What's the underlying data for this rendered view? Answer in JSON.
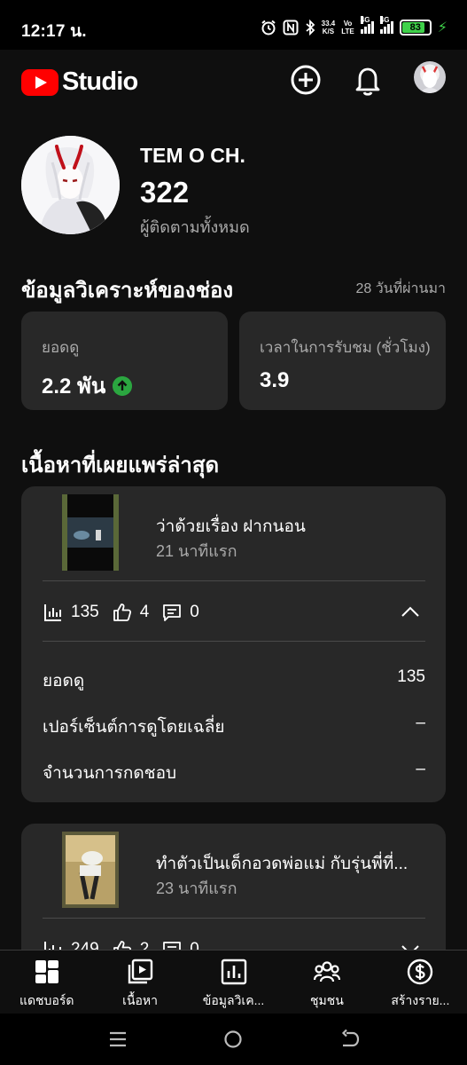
{
  "status_bar": {
    "time": "12:17 น.",
    "speed_value": "33.4",
    "speed_unit": "K/S",
    "volte_top": "Vo",
    "volte_bottom": "LTE",
    "net1": "4G",
    "net2": "4G",
    "battery": "83"
  },
  "app": {
    "logo_text": "Studio"
  },
  "channel": {
    "name": "TEM O CH.",
    "subscriber_count": "322",
    "subscriber_label": "ผู้ติดตามทั้งหมด"
  },
  "analytics": {
    "title": "ข้อมูลวิเคราะห์ของช่อง",
    "period": "28 วันที่ผ่านมา",
    "cards": [
      {
        "label": "ยอดดู",
        "value": "2.2 พัน",
        "trend": "up"
      },
      {
        "label": "เวลาในการรับชม (ชั่วโมง)",
        "value": "3.9"
      }
    ]
  },
  "latest": {
    "title": "เนื้อหาที่เผยแพร่ล่าสุด",
    "videos": [
      {
        "title": "ว่าด้วยเรื่อง ฝากนอน",
        "time": "21 นาทีแรก",
        "views": "135",
        "likes": "4",
        "comments": "0",
        "details": [
          {
            "label": "ยอดดู",
            "value": "135"
          },
          {
            "label": "เปอร์เซ็นต์การดูโดยเฉลี่ย",
            "value": "–"
          },
          {
            "label": "จำนวนการกดชอบ",
            "value": "–"
          }
        ]
      },
      {
        "title": "ทำตัวเป็นเด็กอวดพ่อแม่ กับรุ่นพี่ที่...",
        "time": "23 นาทีแรก",
        "views": "249",
        "likes": "2",
        "comments": "0"
      }
    ]
  },
  "bottom_nav": {
    "items": [
      {
        "label": "แดชบอร์ด",
        "icon": "dashboard-icon",
        "active": true
      },
      {
        "label": "เนื้อหา",
        "icon": "content-icon"
      },
      {
        "label": "ข้อมูลวิเค...",
        "icon": "analytics-icon"
      },
      {
        "label": "ชุมชน",
        "icon": "community-icon"
      },
      {
        "label": "สร้างราย...",
        "icon": "earn-icon"
      }
    ]
  },
  "colors": {
    "accent": "#ff0000",
    "background": "#0f0f0f",
    "card": "#282828",
    "positive": "#2ba640",
    "battery": "#3fd14a"
  }
}
